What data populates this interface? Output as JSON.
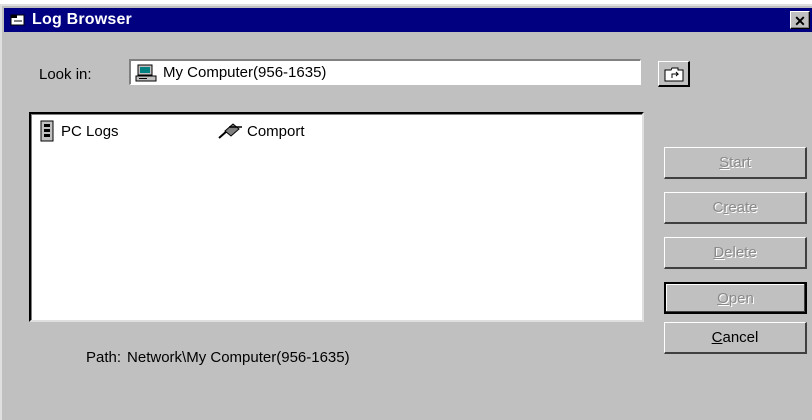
{
  "window": {
    "title": "Log Browser",
    "close_glyph": "✕",
    "title_icon": "log-browser-icon"
  },
  "look_in": {
    "label": "Look in:",
    "value": "My Computer(956-1635)",
    "icon": "computer-icon",
    "up_folder_icon": "up-folder-icon"
  },
  "file_list": {
    "items": [
      {
        "label": "PC Logs",
        "icon": "pc-logs-icon"
      },
      {
        "label": "Comport",
        "icon": "comport-cable-icon"
      }
    ]
  },
  "buttons": {
    "start": {
      "accel": "S",
      "rest": "tart"
    },
    "create": {
      "pre": "C",
      "accel": "r",
      "rest": "eate"
    },
    "delete": {
      "accel": "D",
      "rest": "elete"
    },
    "open": {
      "accel": "O",
      "rest": "pen"
    },
    "cancel": {
      "accel": "C",
      "rest": "ancel"
    }
  },
  "path": {
    "label": "Path:",
    "value": "Network\\My Computer(956-1635)"
  }
}
